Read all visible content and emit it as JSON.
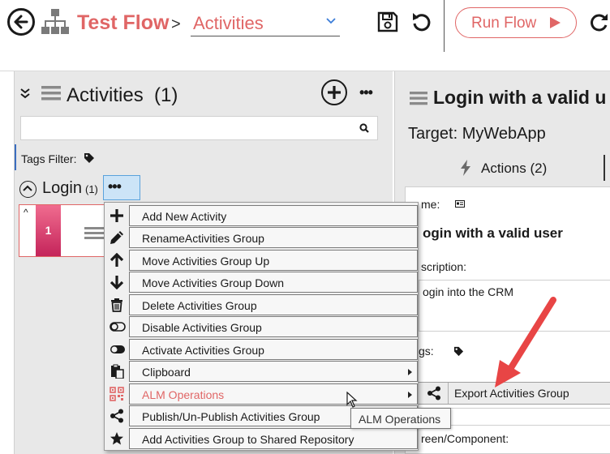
{
  "header": {
    "flow_title": "Test Flow",
    "breadcrumb_separator": ">",
    "view_selected": "Activities",
    "run_button_label": "Run Flow"
  },
  "activities_panel": {
    "title": "Activities  (1)",
    "more_label": "•••",
    "search_value": "",
    "tags_filter_label": "Tags Filter:",
    "group": {
      "name": "Login",
      "count": "(1)",
      "menu_button_label": "•••"
    },
    "activity_card": {
      "number": "1"
    }
  },
  "activity_detail": {
    "title": "Login with a valid u",
    "target": "Target: MyWebApp",
    "actions_tab_label": "Actions (2)",
    "name_label": "me:",
    "name_value": "ogin with a valid user",
    "description_label": "scription:",
    "description_value": "ogin into the CRM",
    "tags_label": "gs:",
    "screen_label": "reen/Component:"
  },
  "context_menu": {
    "items": [
      {
        "label": "Add New Activity",
        "icon": "plus-icon",
        "submenu": false
      },
      {
        "label": "RenameActivities Group",
        "icon": "pencil-icon",
        "submenu": false
      },
      {
        "label": "Move Activities Group Up",
        "icon": "arrow-up-icon",
        "submenu": false
      },
      {
        "label": "Move Activities Group Down",
        "icon": "arrow-down-icon",
        "submenu": false
      },
      {
        "label": "Delete Activities Group",
        "icon": "trash-icon",
        "submenu": false
      },
      {
        "label": "Disable Activities Group",
        "icon": "toggle-off-icon",
        "submenu": false
      },
      {
        "label": "Activate Activities Group",
        "icon": "toggle-on-icon",
        "submenu": false
      },
      {
        "label": "Clipboard",
        "icon": "clipboard-icon",
        "submenu": true
      },
      {
        "label": "ALM Operations",
        "icon": "qr-code-icon",
        "submenu": true
      },
      {
        "label": "Publish/Un-Publish Activities Group",
        "icon": "share-icon",
        "submenu": false
      },
      {
        "label": "Add Activities Group to Shared Repository",
        "icon": "star-icon",
        "submenu": false
      }
    ]
  },
  "submenu": {
    "export_label": "Export Activities Group"
  },
  "tooltip": {
    "text": "ALM Operations"
  },
  "colors": {
    "accent": "#e06666",
    "card_number_bg": "#d9336a",
    "highlight_blue": "#cce4f7",
    "panel_bg": "#e8e8e8",
    "annotation_arrow": "#e84545"
  }
}
